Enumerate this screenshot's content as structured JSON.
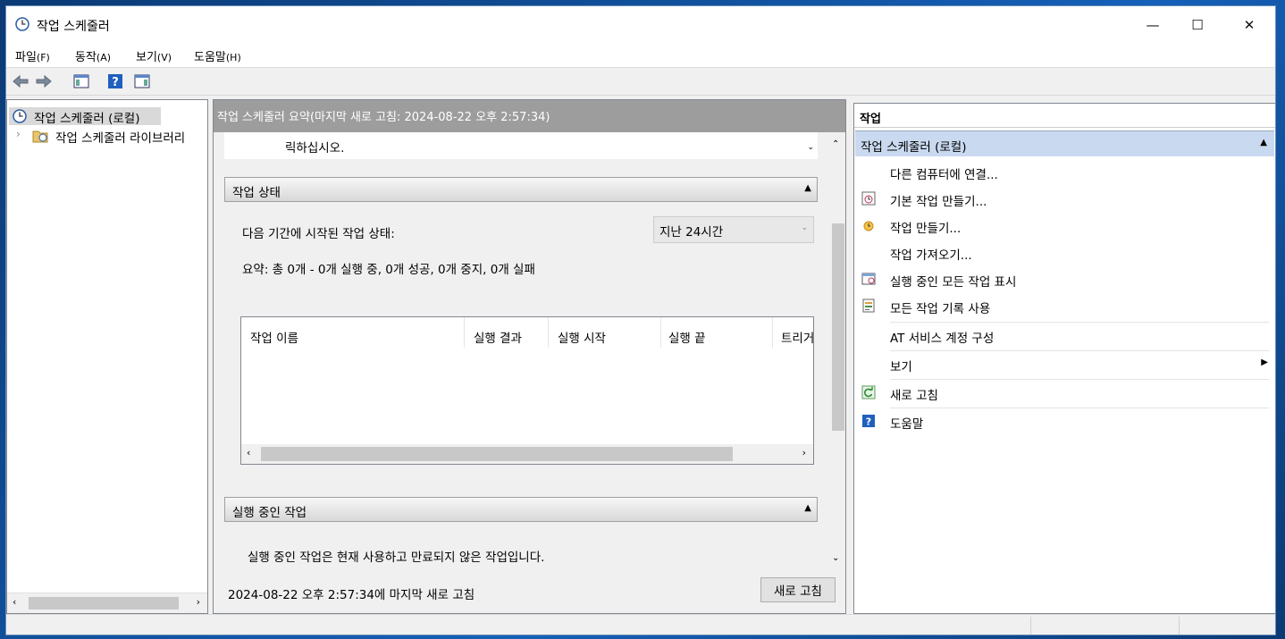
{
  "window": {
    "title": "작업 스케줄러",
    "minimize_label": "—",
    "maximize_label": "☐",
    "close_label": "✕"
  },
  "menu": [
    {
      "label": "파일",
      "key": "(F)"
    },
    {
      "label": "동작",
      "key": "(A)"
    },
    {
      "label": "보기",
      "key": "(V)"
    },
    {
      "label": "도움말",
      "key": "(H)"
    }
  ],
  "tree": {
    "root": "작업 스케줄러 (로컬)",
    "child": "작업 스케줄러 라이브러리"
  },
  "main": {
    "header": "작업 스케줄러 요약(마지막 새로 고침: 2024-08-22 오후 2:57:34)",
    "cut_text": "릭하십시오.",
    "status_section": {
      "title": "작업 상태",
      "period_label": "다음 기간에 시작된 작업 상태:",
      "period_value": "지난 24시간",
      "summary": "요약: 총 0개 - 0개 실행 중, 0개 성공, 0개 중지, 0개 실패",
      "columns": [
        "작업 이름",
        "실행 결과",
        "실행 시작",
        "실행 끝",
        "트리거"
      ]
    },
    "running_section": {
      "title": "실행 중인 작업",
      "description": "실행 중인 작업은 현재 사용하고 만료되지 않은 작업입니다."
    },
    "footer_text": "2024-08-22 오후 2:57:34에 마지막 새로 고침",
    "refresh_button": "새로 고침"
  },
  "actions": {
    "title": "작업",
    "group": "작업 스케줄러 (로컬)",
    "items": [
      {
        "label": "다른 컴퓨터에 연결...",
        "icon": "none"
      },
      {
        "label": "기본 작업 만들기...",
        "icon": "basic-task-icon"
      },
      {
        "label": "작업 만들기...",
        "icon": "create-task-icon"
      },
      {
        "label": "작업 가져오기...",
        "icon": "none"
      },
      {
        "label": "실행 중인 모든 작업 표시",
        "icon": "running-tasks-icon"
      },
      {
        "label": "모든 작업 기록 사용",
        "icon": "history-icon"
      },
      {
        "label": "AT 서비스 계정 구성",
        "icon": "none"
      },
      {
        "label": "보기",
        "icon": "none"
      },
      {
        "label": "새로 고침",
        "icon": "refresh-icon"
      },
      {
        "label": "도움말",
        "icon": "help-icon"
      }
    ]
  },
  "colors": {
    "accent": "#c9d9ef",
    "header_gray": "#9d9d9d",
    "help_blue": "#1f5fbf"
  }
}
